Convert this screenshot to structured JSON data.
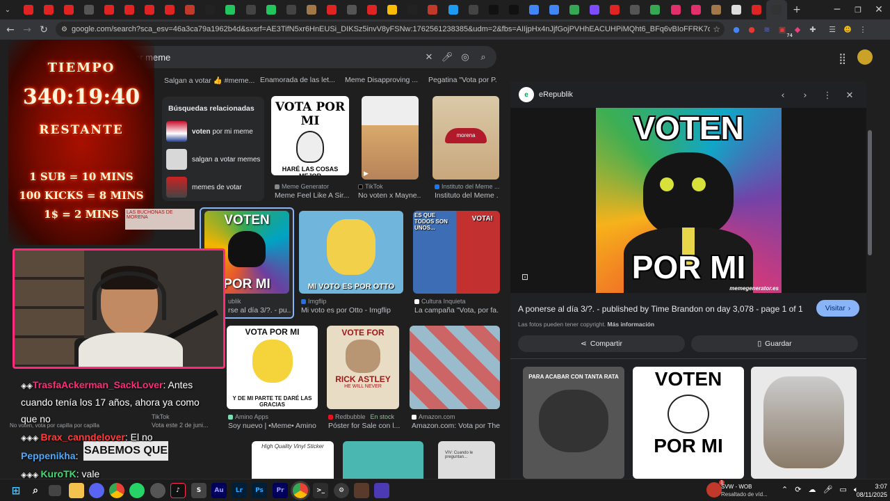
{
  "browser": {
    "url": "google.com/search?sca_esv=46a3ca79a1962b4d&sxsrf=AE3TifN5xr6HnEUSi_DIKSz5invV8yFSNw:1762561238385&udm=2&fbs=AIIjpHx4nJjfGojPVHhEACUHPiMQht6_BFq6vBIoFFRK7qchKHDX9TtpZ996kyQpCWcw0Whoq...",
    "ext_badge": "74"
  },
  "search": {
    "query": "or meme"
  },
  "results": {
    "top_captions": [
      "Salgan a votar 👍 #meme...",
      "Enamorada de las let...",
      "Meme Disapproving ...",
      "Pegatina \"Vota por P..."
    ],
    "related_title": "Búsquedas relacionadas",
    "related": [
      {
        "bold": "voten",
        "rest": " por mi meme"
      },
      {
        "bold": "",
        "rest": "salgan a votar memes"
      },
      {
        "bold": "",
        "rest": "memes de votar"
      }
    ],
    "row1": [
      {
        "img_text": "VOTA POR MI",
        "img_sub": "HARÉ LAS COSAS MEJOR",
        "source": "Meme Generator",
        "caption": "Meme Feel Like A Sir..."
      },
      {
        "img_text": "",
        "img_sub": "",
        "source": "TikTok",
        "caption": "No voten x Mayne..."
      },
      {
        "img_text": "morena",
        "img_sub": "",
        "source": "Instituto del Meme ...",
        "caption": "Instituto del Meme ..."
      }
    ],
    "row2": [
      {
        "img_text": "VOTEN",
        "img_sub": "POR MI",
        "source": "ublik",
        "caption": "rse al día 3/?. - pu..."
      },
      {
        "img_text": "MI VOTO ES POR OTTO",
        "img_sub": "",
        "source": "Imgflip",
        "caption": "Mi voto es por Otto - Imgflip"
      },
      {
        "img_text": "ES QUE TODOS SON UNOS...",
        "img_sub": "VOTA!",
        "source": "Cultura Inquieta",
        "caption": "La campaña \"Vota, por fa..."
      }
    ],
    "row3": [
      {
        "img_text": "VOTA POR MI",
        "img_sub": "Y DE MI PARTE TE DARÉ LAS GRACIAS",
        "source": "Amino Apps",
        "caption": "Soy nuevo | •Meme• Amino"
      },
      {
        "img_text": "VOTE FOR",
        "img_sub": "RICK ASTLEY",
        "img_sub2": "HE WILL NEVER",
        "source": "Redbubble",
        "stock": "En stock",
        "caption": "Póster for Sale con l..."
      },
      {
        "img_text": "",
        "img_sub": "",
        "source": "Amazon.com",
        "caption": "Amazon.com: Vota por The..."
      }
    ],
    "left_captions": {
      "tiktok": "TikTok",
      "tiktok_sub": "Vota este 2 de juni...",
      "vote_small": "No voten, vota por capilla por capilla"
    },
    "row4_text": [
      "High Quality Vinyl Sticker",
      "",
      "VIV: Cuando le preguntan..."
    ]
  },
  "preview": {
    "source": "eRepublik",
    "img_top": "VOTEN",
    "img_bottom": "POR MI",
    "watermark": "memegenerator.es",
    "title": "A ponerse al día 3/?. - published by Time Brandon on day 3,078 - page 1 of 1",
    "visit_label": "Visitar",
    "copyright": "Las fotos pueden tener copyright.",
    "more_info": "Más información",
    "share_label": "Compartir",
    "save_label": "Guardar",
    "related": [
      {
        "text": "PARA ACABAR CON TANTA RATA"
      },
      {
        "text": "VOTEN",
        "sub": "POR MI"
      },
      {
        "text": ""
      }
    ]
  },
  "overlay": {
    "timer_title": "TIEMPO",
    "timer_value": "340:19:40",
    "timer_remaining": "RESTANTE",
    "rule1": "1 SUB = 10 MINS",
    "rule2": "100 KICKS = 8 MINS",
    "rule3": "1$ = 2 MINS",
    "bg_text": "SABEMOS QUE",
    "bg_sign": "LAS BUCHONAS DE MORENA",
    "chat": [
      {
        "user": "TrasfaAckerman_SackLover",
        "text": ": Antes",
        "color": "#ff2a7a"
      },
      {
        "user": "",
        "text": "cuando tenía los 17 años, ahora ya como",
        "color": ""
      },
      {
        "user": "",
        "text": "que no",
        "color": ""
      },
      {
        "user": "Brax_canndelover",
        "text": ": El no",
        "color": "#ff3b3b"
      },
      {
        "user": "Peppenikha",
        "text": ":",
        "color": "#4aa8ff"
      },
      {
        "user": "KuroTK",
        "text": ": vale",
        "color": "#3fdc6a"
      }
    ]
  },
  "taskbar": {
    "tray_title": "SVW - WOB",
    "tray_sub": "Resaltado de víd...",
    "tray_badge": "1",
    "time": "3:07",
    "date": "08/11/2025"
  }
}
